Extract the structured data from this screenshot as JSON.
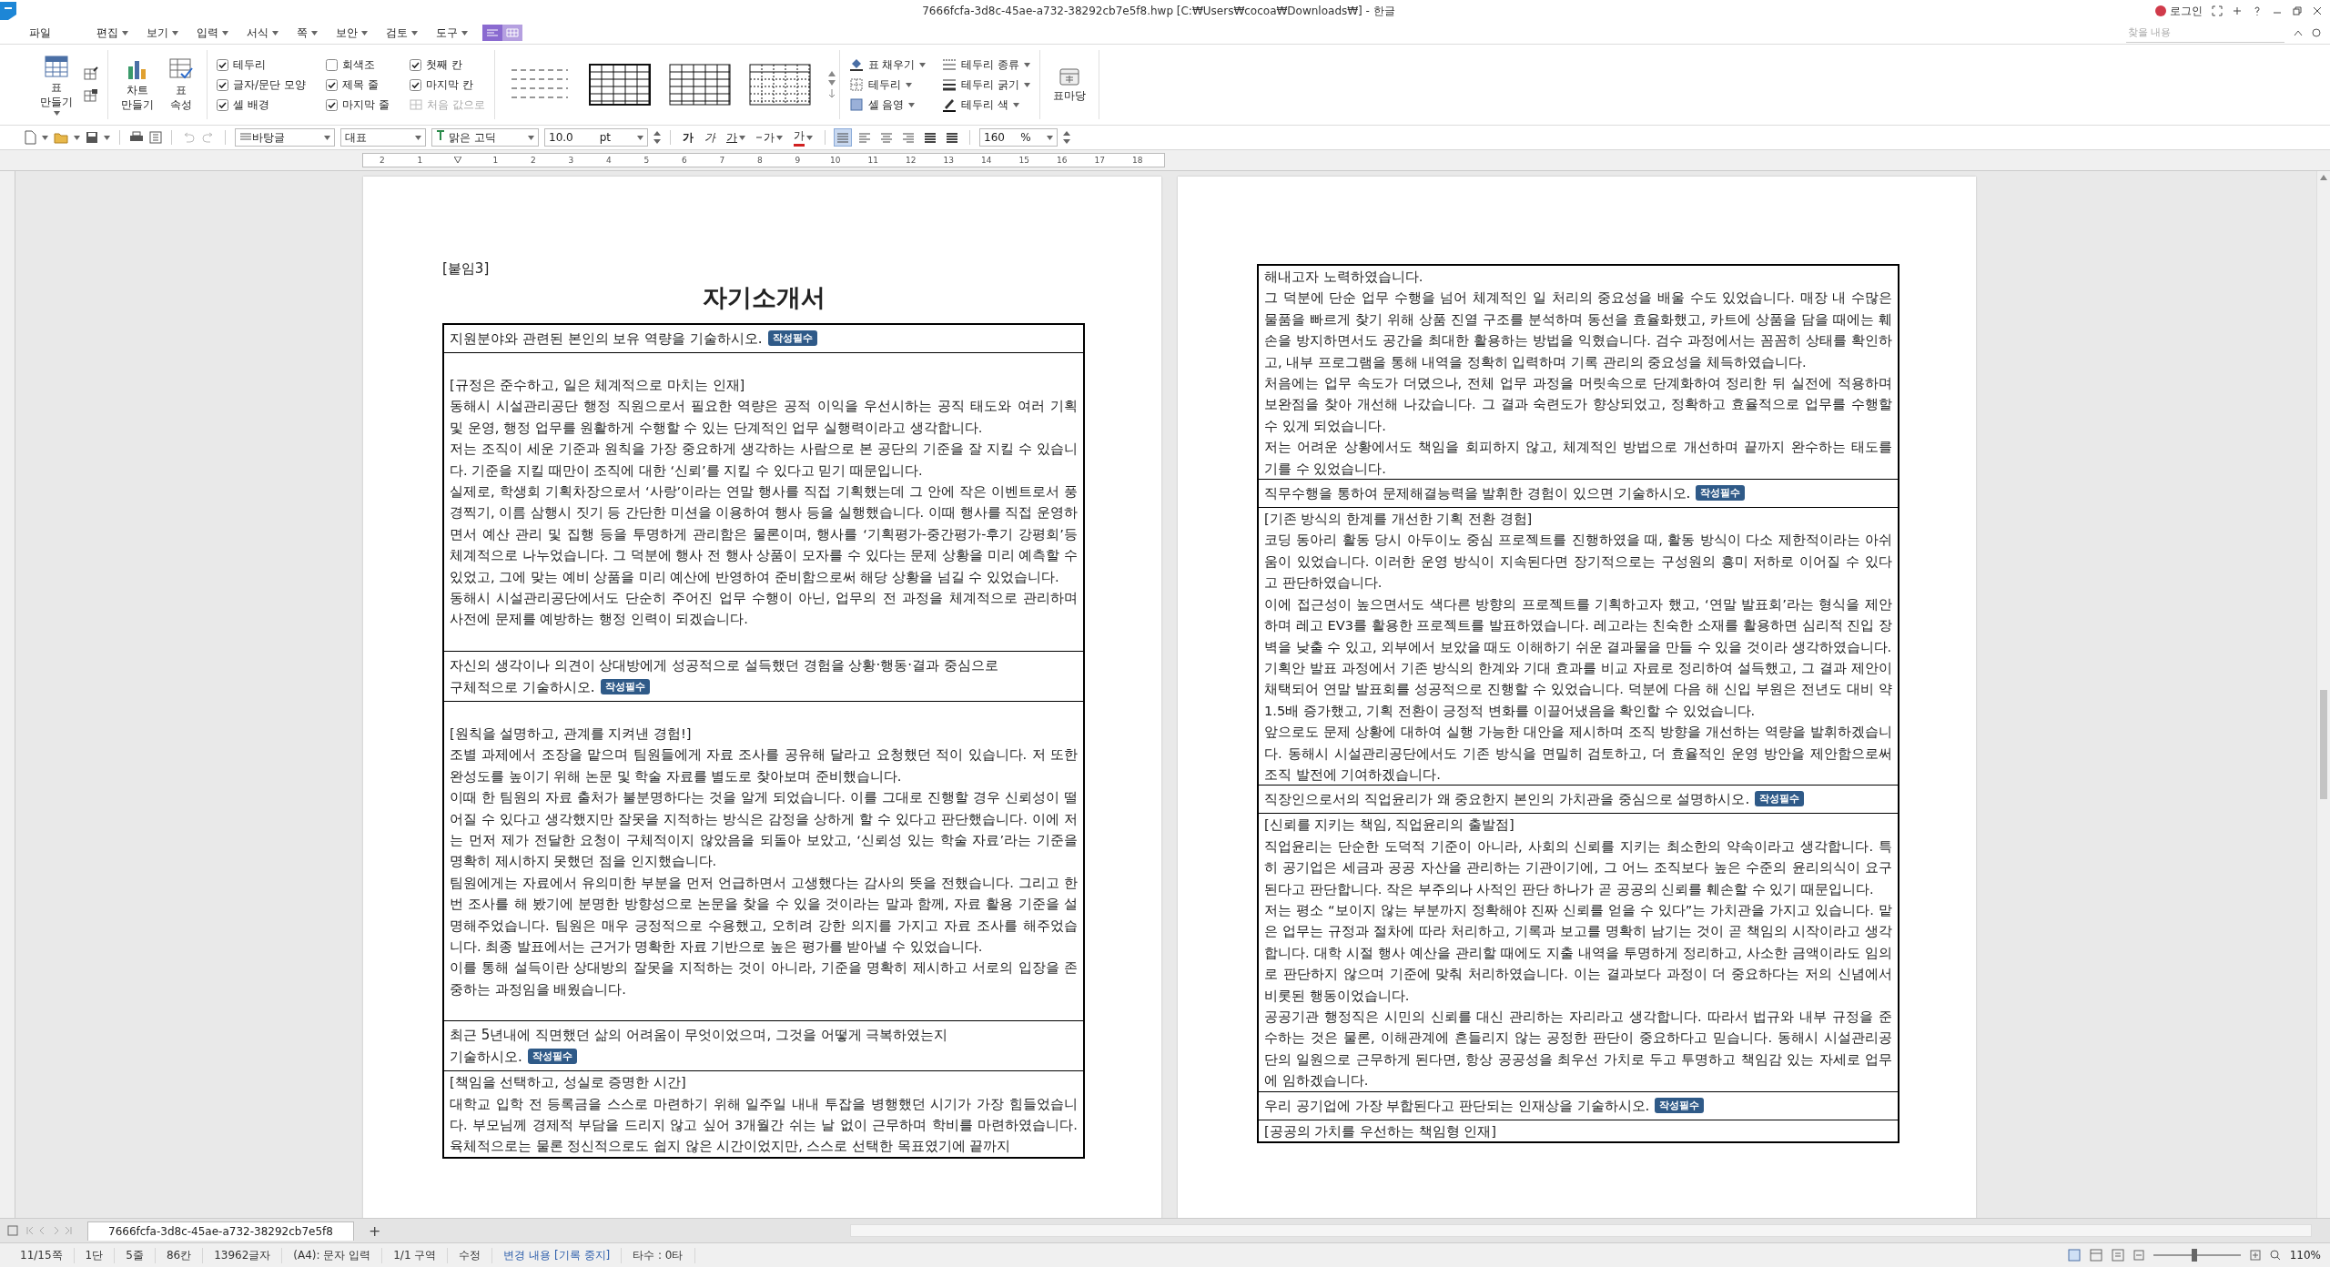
{
  "title_bar": {
    "title": "7666fcfa-3d8c-45ae-a732-38292cb7e5f8.hwp [C:₩Users₩cocoa₩Downloads₩] - 한글",
    "login": "로그인"
  },
  "menu": [
    {
      "label": "파일",
      "dropdown": false
    },
    {
      "label": "편집",
      "dropdown": true
    },
    {
      "label": "보기",
      "dropdown": true
    },
    {
      "label": "입력",
      "dropdown": true
    },
    {
      "label": "서식",
      "dropdown": true
    },
    {
      "label": "쪽",
      "dropdown": true
    },
    {
      "label": "보안",
      "dropdown": true
    },
    {
      "label": "검토",
      "dropdown": true
    },
    {
      "label": "도구",
      "dropdown": true
    }
  ],
  "view_modes": [
    {
      "selected": true
    },
    {
      "selected": false
    }
  ],
  "search": {
    "placeholder": "찾을 내용"
  },
  "ribbon": {
    "table_buttons": [
      {
        "label": "표\n만들기",
        "dropdown": true,
        "kind": "create"
      },
      {
        "label": "차트\n만들기",
        "dropdown": false,
        "kind": "chart"
      },
      {
        "label": "표\n속성",
        "dropdown": false,
        "kind": "props"
      }
    ],
    "options": [
      {
        "label": "테두리",
        "checked": true
      },
      {
        "label": "글자/문단 모양",
        "checked": true
      },
      {
        "label": "셀 배경",
        "checked": true
      },
      {
        "label": "회색조",
        "checked": false
      },
      {
        "label": "제목 줄",
        "checked": true
      },
      {
        "label": "마지막 줄",
        "checked": true
      },
      {
        "label": "첫째 칸",
        "checked": true
      },
      {
        "label": "마지막 칸",
        "checked": true
      }
    ],
    "reset": {
      "label": "처음 값으로",
      "disabled": true
    },
    "styles": [
      {
        "kind": "plain"
      },
      {
        "kind": "heavy"
      },
      {
        "kind": "light"
      },
      {
        "kind": "dotted"
      }
    ],
    "tools": [
      {
        "label": "표 채우기",
        "kind": "fill"
      },
      {
        "label": "테두리",
        "kind": "border"
      },
      {
        "label": "셀 음영",
        "kind": "shade"
      },
      {
        "label": "테두리 종류",
        "kind": "line-type"
      },
      {
        "label": "테두리 굵기",
        "kind": "line-weight"
      },
      {
        "label": "테두리 색",
        "kind": "line-color"
      }
    ],
    "gallery_button": "표마당"
  },
  "format_bar": {
    "style": "바탕글",
    "lang": "대표",
    "font": "맑은 고딕",
    "size": "10.0",
    "unit": "pt",
    "char_buttons": [
      {
        "label": "가",
        "kind": "bold"
      },
      {
        "label": "가",
        "kind": "italic"
      },
      {
        "label": "가",
        "kind": "underline"
      },
      {
        "label": "가",
        "kind": "strike"
      },
      {
        "label": "가",
        "kind": "color"
      }
    ],
    "align": [
      {
        "kind": "justify",
        "selected": true
      },
      {
        "kind": "left",
        "selected": false
      },
      {
        "kind": "center",
        "selected": false
      },
      {
        "kind": "right",
        "selected": false
      },
      {
        "kind": "distribute",
        "selected": false
      },
      {
        "kind": "split",
        "selected": false
      }
    ],
    "zoom": "160",
    "zoom_unit": "%"
  },
  "ruler": [
    "2",
    "1",
    "1",
    "2",
    "3",
    "4",
    "5",
    "6",
    "7",
    "8",
    "9",
    "10",
    "11",
    "12",
    "13",
    "14",
    "15",
    "16",
    "17",
    "18"
  ],
  "pages": [
    {
      "label": "[붙임3]",
      "title": "자기소개서",
      "rows": [
        {
          "kind": "question",
          "text": "지원분야와 관련된 본인의 보유 역량을 기술하시오.",
          "badge": "작성필수"
        },
        {
          "kind": "answer",
          "padded": true,
          "heading": "[규정은 준수하고, 일은 체계적으로 마치는 인재]",
          "paragraphs": [
            "동해시 시설관리공단 행정 직원으로서 필요한 역량은 공적 이익을 우선시하는 공직 태도와 여러 기획 및 운영, 행정 업무를 원활하게 수행할 수 있는 단계적인 업무 실행력이라고 생각합니다.",
            "저는 조직이 세운 기준과 원칙을 가장 중요하게 생각하는 사람으로 본 공단의 기준을 잘 지킬 수 있습니다. 기준을 지킬 때만이 조직에 대한 ‘신뢰’를 지킬 수 있다고 믿기 때문입니다.",
            "실제로, 학생회 기획차장으로서 ‘사랑’이라는 연말 행사를 직접 기획했는데 그 안에 작은 이벤트로서 풍경찍기, 이름 삼행시 짓기 등 간단한 미션을 이용하여 행사 등을 실행했습니다. 이때 행사를 직접 운영하면서 예산 관리 및 집행 등을 투명하게 관리함은 물론이며, 행사를 ‘기획평가-중간평가-후기 강평회’등 체계적으로 나누었습니다. 그 덕분에 행사 전 행사 상품이 모자를 수 있다는 문제 상황을 미리 예측할 수 있었고, 그에 맞는 예비 상품을 미리 예산에 반영하여 준비함으로써 해당 상황을 넘길 수 있었습니다.",
            "동해시 시설관리공단에서도 단순히 주어진 업무 수행이 아닌, 업무의 전 과정을 체계적으로 관리하며 사전에 문제를 예방하는 행정 인력이 되겠습니다."
          ]
        },
        {
          "kind": "question",
          "text": "자신의 생각이나 의견이 상대방에게 성공적으로 설득했던 경험을 상황·행동·결과 중심으로\n구체적으로 기술하시오.",
          "badge": "작성필수"
        },
        {
          "kind": "answer",
          "padded": true,
          "heading": "[원칙을 설명하고, 관계를 지켜낸 경험!]",
          "paragraphs": [
            "조별 과제에서 조장을 맡으며 팀원들에게 자료 조사를 공유해 달라고 요청했던 적이 있습니다. 저 또한 완성도를 높이기 위해 논문 및 학술 자료를 별도로 찾아보며 준비했습니다.",
            "이때 한 팀원의 자료 출처가 불분명하다는 것을 알게 되었습니다. 이를 그대로 진행할 경우 신뢰성이 떨어질 수 있다고 생각했지만 잘못을 지적하는 방식은 감정을 상하게 할 수 있다고 판단했습니다. 이에 저는 먼저 제가 전달한 요청이 구체적이지 않았음을 되돌아 보았고, ‘신뢰성 있는 학술 자료’라는 기준을 명확히 제시하지 못했던 점을 인지했습니다.",
            "팀원에게는 자료에서 유의미한 부분을 먼저 언급하면서 고생했다는 감사의 뜻을 전했습니다. 그리고 한 번 조사를 해 봤기에 분명한 방향성으로 논문을 찾을 수 있을 것이라는 말과 함께, 자료 활용 기준을 설명해주었습니다. 팀원은 매우 긍정적으로 수용했고, 오히려 강한 의지를 가지고 자료 조사를 해주었습니다. 최종 발표에서는 근거가 명확한 자료 기반으로 높은 평가를 받아낼 수 있었습니다.",
            "이를 통해 설득이란 상대방의 잘못을 지적하는 것이 아니라, 기준을 명확히 제시하고 서로의 입장을 존중하는 과정임을 배웠습니다."
          ]
        },
        {
          "kind": "question",
          "text": "최근 5년내에 직면했던 삶의 어려움이 무엇이었으며, 그것을 어떻게 극복하였는지\n기술하시오.",
          "badge": "작성필수"
        },
        {
          "kind": "answer",
          "padded": false,
          "heading": "[책임을 선택하고, 성실로 증명한 시간]",
          "paragraphs": [
            "대학교 입학 전 등록금을 스스로 마련하기 위해 일주일 내내 투잡을 병행했던 시기가 가장 힘들었습니다. 부모님께 경제적 부담을 드리지 않고 싶어 3개월간 쉬는 날 없이 근무하며 학비를 마련하였습니다. 육체적으로는 물론 정신적으로도 쉽지 않은 시간이었지만, 스스로 선택한 목표였기에 끝까지"
          ]
        }
      ]
    },
    {
      "rows": [
        {
          "kind": "answer",
          "padded": false,
          "paragraphs": [
            "해내고자 노력하였습니다.",
            "그 덕분에 단순 업무 수행을 넘어 체계적인 일 처리의 중요성을 배울 수도 있었습니다. 매장 내 수많은 물품을 빠르게 찾기 위해 상품 진열 구조를 분석하며 동선을 효율화했고, 카트에 상품을 담을 때에는 훼손을 방지하면서도 공간을 최대한 활용하는 방법을 익혔습니다. 검수 과정에서는 꼼꼼히 상태를 확인하고, 내부 프로그램을 통해 내역을 정확히 입력하며 기록 관리의 중요성을 체득하였습니다.",
            "처음에는 업무 속도가 더뎠으나, 전체 업무 과정을 머릿속으로 단계화하여 정리한 뒤 실전에 적용하며 보완점을 찾아 개선해 나갔습니다. 그 결과 숙련도가 향상되었고, 정확하고 효율적으로 업무를 수행할 수 있게 되었습니다.",
            "저는 어려운 상황에서도 책임을 회피하지 않고, 체계적인 방법으로 개선하며 끝까지 완수하는 태도를 기를 수 있었습니다."
          ]
        },
        {
          "kind": "question",
          "text": "직무수행을 통하여 문제해결능력을 발휘한 경험이 있으면 기술하시오.",
          "badge": "작성필수"
        },
        {
          "kind": "answer",
          "padded": false,
          "heading": "[기존 방식의 한계를 개선한 기획 전환 경험]",
          "paragraphs": [
            "코딩 동아리 활동 당시 아두이노 중심 프로젝트를 진행하였을 때, 활동 방식이 다소 제한적이라는 아쉬움이 있었습니다. 이러한 운영 방식이 지속된다면 장기적으로는 구성원의 흥미 저하로 이어질 수 있다고 판단하였습니다.",
            "이에 접근성이 높으면서도 색다른 방향의 프로젝트를 기획하고자 했고, ‘연말 발표회’라는 형식을 제안하며 레고 EV3를 활용한 프로젝트를 발표하였습니다. 레고라는 친숙한 소재를 활용하면 심리적 진입 장벽을 낮출 수 있고, 외부에서 보았을 때도 이해하기 쉬운 결과물을 만들 수 있을 것이라 생각하였습니다.",
            "기획안 발표 과정에서 기존 방식의 한계와 기대 효과를 비교 자료로 정리하여 설득했고, 그 결과 제안이 채택되어 연말 발표회를 성공적으로 진행할 수 있었습니다. 덕분에 다음 해 신입 부원은 전년도 대비 약 1.5배 증가했고, 기획 전환이 긍정적 변화를 이끌어냈음을 확인할 수 있었습니다.",
            "앞으로도 문제 상황에 대하여 실행 가능한 대안을 제시하며 조직 방향을 개선하는 역량을 발휘하겠습니다. 동해시 시설관리공단에서도 기존 방식을 면밀히 검토하고, 더 효율적인 운영 방안을 제안함으로써 조직 발전에 기여하겠습니다."
          ]
        },
        {
          "kind": "question",
          "text": "직장인으로서의 직업윤리가 왜 중요한지 본인의 가치관을 중심으로 설명하시오.",
          "badge": "작성필수"
        },
        {
          "kind": "answer",
          "padded": false,
          "heading": "[신뢰를 지키는 책임, 직업윤리의 출발점]",
          "paragraphs": [
            "직업윤리는 단순한 도덕적 기준이 아니라, 사회의 신뢰를 지키는 최소한의 약속이라고 생각합니다. 특히 공기업은 세금과 공공 자산을 관리하는 기관이기에, 그 어느 조직보다 높은 수준의 윤리의식이 요구된다고 판단합니다. 작은 부주의나 사적인 판단 하나가 곧 공공의 신뢰를 훼손할 수 있기 때문입니다.",
            "저는 평소 “보이지 않는 부분까지 정확해야 진짜 신뢰를 얻을 수 있다”는 가치관을 가지고 있습니다. 맡은 업무는 규정과 절차에 따라 처리하고, 기록과 보고를 명확히 남기는 것이 곧 책임의 시작이라고 생각합니다. 대학 시절 행사 예산을 관리할 때에도 지출 내역을 투명하게 정리하고, 사소한 금액이라도 임의로 판단하지 않으며 기준에 맞춰 처리하였습니다. 이는 결과보다 과정이 더 중요하다는 저의 신념에서 비롯된 행동이었습니다.",
            "공공기관 행정직은 시민의 신뢰를 대신 관리하는 자리라고 생각합니다. 따라서 법규와 내부 규정을 준수하는 것은 물론, 이해관계에 흔들리지 않는 공정한 판단이 중요하다고 믿습니다. 동해시 시설관리공단의 일원으로 근무하게 된다면, 항상 공공성을 최우선 가치로 두고 투명하고 책임감 있는 자세로 업무에 임하겠습니다."
          ]
        },
        {
          "kind": "question",
          "text": "우리 공기업에 가장 부합된다고 판단되는 인재상을 기술하시오.",
          "badge": "작성필수"
        },
        {
          "kind": "answer",
          "padded": false,
          "heading": "[공공의 가치를 우선하는 책임형 인재]"
        }
      ]
    }
  ],
  "doc_tabs": [
    {
      "label": "7666fcfa-3d8c-45ae-a732-38292cb7e5f8",
      "selected": true
    }
  ],
  "add_tab": "+",
  "status_bar": [
    {
      "text": "11/15쪽",
      "kind": "plain"
    },
    {
      "text": "1단",
      "kind": "plain"
    },
    {
      "text": "5줄",
      "kind": "plain"
    },
    {
      "text": "86칸",
      "kind": "plain"
    },
    {
      "text": "13962글자",
      "kind": "plain"
    },
    {
      "text": "(A4): 문자 입력",
      "kind": "plain"
    },
    {
      "text": "1/1 구역",
      "kind": "plain"
    },
    {
      "text": "수정",
      "kind": "plain"
    },
    {
      "text": "변경 내용 [기록 중지]",
      "kind": "link"
    },
    {
      "text": "타수 : 0타",
      "kind": "plain"
    }
  ],
  "zoom": {
    "text": "110%",
    "level": 0.47
  }
}
